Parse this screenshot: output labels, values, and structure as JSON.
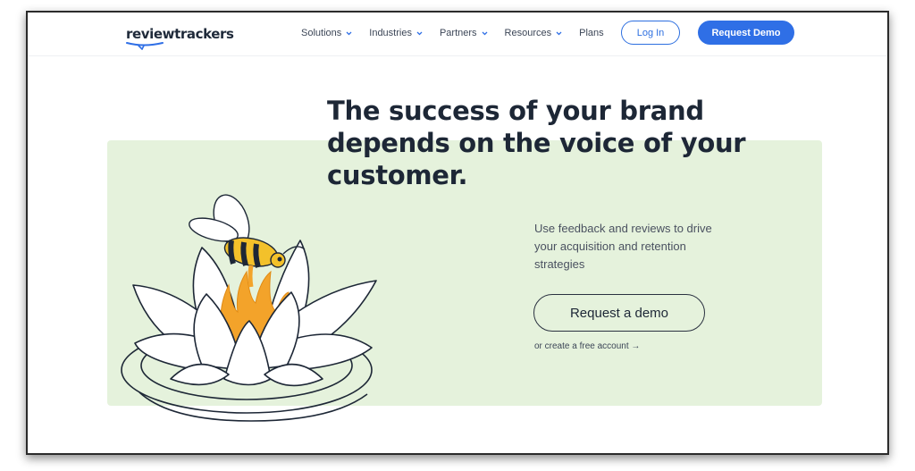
{
  "brand": {
    "name": "reviewtrackers",
    "accent": "#2f6fe6",
    "panel_color": "#e5f2dc"
  },
  "nav": {
    "items": [
      {
        "label": "Solutions",
        "has_dropdown": true
      },
      {
        "label": "Industries",
        "has_dropdown": true
      },
      {
        "label": "Partners",
        "has_dropdown": true
      },
      {
        "label": "Resources",
        "has_dropdown": true
      },
      {
        "label": "Plans",
        "has_dropdown": false
      }
    ],
    "login_label": "Log In",
    "demo_label": "Request Demo"
  },
  "hero": {
    "headline": "The success of your brand depends on the voice of your customer.",
    "subtext": "Use feedback and reviews to drive your acquisition and retention strategies",
    "cta_label": "Request a demo",
    "secondary_link": "or create a free account →",
    "illustration": "bee-on-water-lily"
  },
  "icons": {
    "dropdown": "chevron-down-icon"
  }
}
